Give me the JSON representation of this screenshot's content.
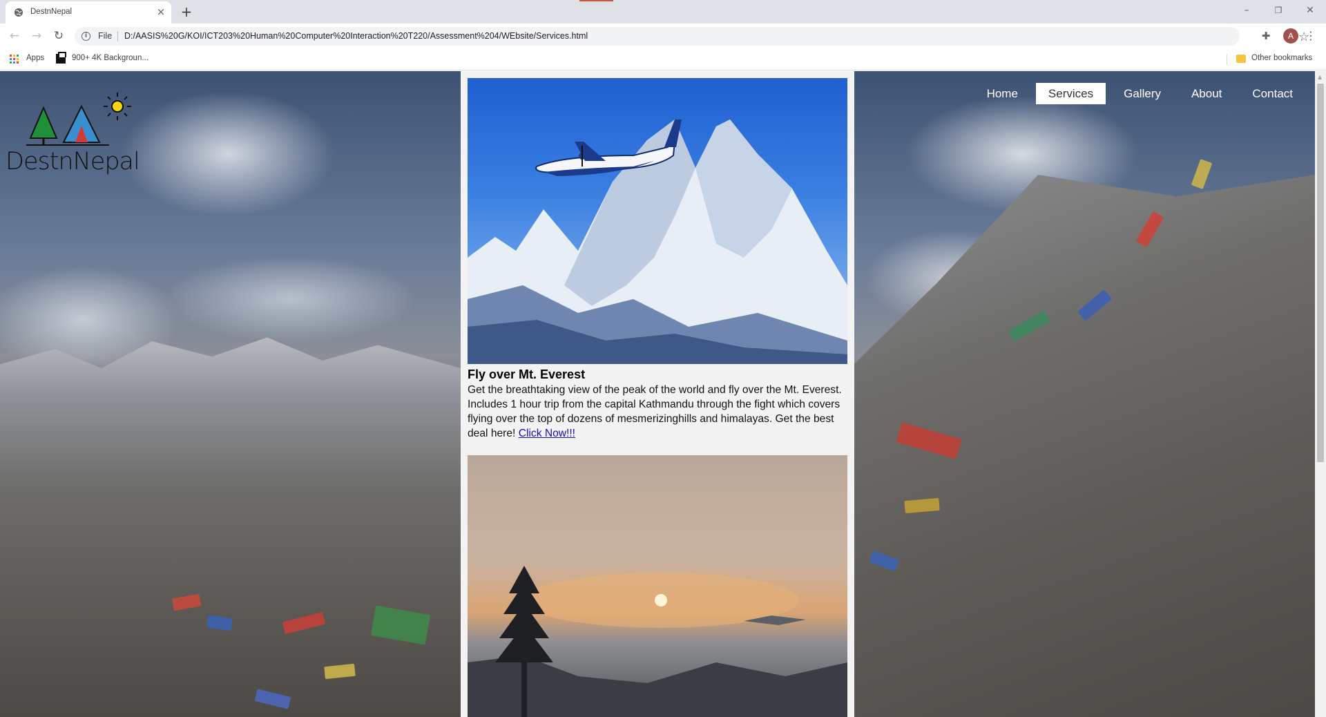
{
  "browser": {
    "tab_title": "DestnNepal",
    "new_tab": "+",
    "tab_close": "×",
    "scheme_label": "File",
    "url": "D:/AASIS%20G/KOI/ICT203%20Human%20Computer%20Interaction%20T220/Assessment%204/WEbsite/Services.html",
    "window_controls": [
      "–",
      "❐",
      "✕"
    ],
    "bookmarks": [
      {
        "label": "Apps",
        "icon": "apps-grid-icon"
      },
      {
        "label": "900+ 4K Backgroun...",
        "icon": "bookmark-favicon"
      }
    ],
    "other_bookmarks": "Other bookmarks",
    "profile_initial": "A"
  },
  "site": {
    "logo_text": "DestnNepal",
    "nav": [
      {
        "label": "Home",
        "active": false
      },
      {
        "label": "Services",
        "active": true
      },
      {
        "label": "Gallery",
        "active": false
      },
      {
        "label": "About",
        "active": false
      },
      {
        "label": "Contact",
        "active": false
      }
    ]
  },
  "services": [
    {
      "title": "Fly over Mt. Everest",
      "text": "Get the breathtaking view of the peak of the world and fly over the Mt. Everest. Includes 1 hour trip from the capital Kathmandu through the fight which covers flying over the top of dozens of mesmerizinghills and himalayas. Get the best deal here!",
      "link": "Click Now!!!",
      "image": "plane-over-mountain-image"
    },
    {
      "title": "",
      "image": "sunrise-over-clouds-image"
    }
  ],
  "colors": {
    "chrome_bg": "#dee1e6",
    "content_bg": "#f3f3f3",
    "link": "#1a0dab",
    "nav_active_bg": "#ffffff"
  }
}
